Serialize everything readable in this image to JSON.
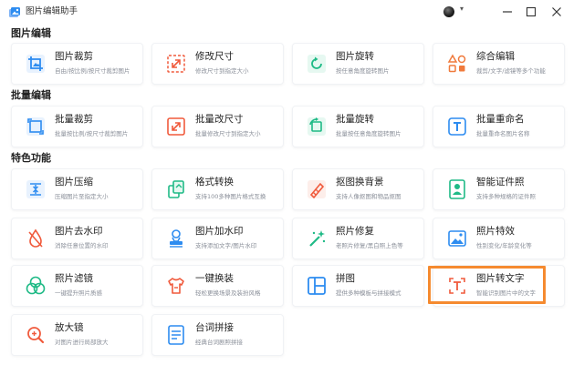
{
  "app": {
    "title": "图片编辑助手",
    "accent": "#2d8cf0"
  },
  "window_controls": {
    "minimize": "minimize-icon",
    "maximize": "maximize-icon",
    "close": "close-icon"
  },
  "sections": [
    {
      "title": "图片编辑"
    },
    {
      "title": "批量编辑"
    },
    {
      "title": "特色功能"
    }
  ],
  "tools": [
    {
      "label": "图片裁剪",
      "desc": "自由/按比例/按尺寸裁剪图片",
      "icon": "crop-icon"
    },
    {
      "label": "修改尺寸",
      "desc": "修改尺寸到指定大小",
      "icon": "resize-icon"
    },
    {
      "label": "图片旋转",
      "desc": "按任意角度旋转图片",
      "icon": "rotate-icon"
    },
    {
      "label": "综合编辑",
      "desc": "裁剪/文字/滤镜等多个功能",
      "icon": "shapes-icon"
    },
    {
      "label": "批量裁剪",
      "desc": "批量按比例/按尺寸裁剪图片",
      "icon": "batch-crop-icon"
    },
    {
      "label": "批量改尺寸",
      "desc": "批量修改尺寸到指定大小",
      "icon": "batch-resize-icon"
    },
    {
      "label": "批量旋转",
      "desc": "批量按任意角度旋转图片",
      "icon": "batch-rotate-icon"
    },
    {
      "label": "批量重命名",
      "desc": "批量重命名图片名称",
      "icon": "rename-icon"
    },
    {
      "label": "图片压缩",
      "desc": "压缩图片至指定大小",
      "icon": "compress-icon"
    },
    {
      "label": "格式转换",
      "desc": "支持100多种图片格式互换",
      "icon": "convert-icon"
    },
    {
      "label": "抠图换背景",
      "desc": "支持人像抠图和物品抠图",
      "icon": "cutout-icon"
    },
    {
      "label": "智能证件照",
      "desc": "支持多种规格的证件照",
      "icon": "id-photo-icon"
    },
    {
      "label": "图片去水印",
      "desc": "消除任意位置的水印",
      "icon": "remove-watermark-icon"
    },
    {
      "label": "图片加水印",
      "desc": "支持添加文字/图片水印",
      "icon": "add-watermark-icon"
    },
    {
      "label": "照片修复",
      "desc": "老照片修复/黑白照上色等",
      "icon": "magic-wand-icon"
    },
    {
      "label": "照片特效",
      "desc": "性别变化/年龄变化等",
      "icon": "effects-icon"
    },
    {
      "label": "照片滤镜",
      "desc": "一键提升照片质感",
      "icon": "filter-icon"
    },
    {
      "label": "一键换装",
      "desc": "轻松更换场景及装扮风格",
      "icon": "outfit-icon"
    },
    {
      "label": "拼图",
      "desc": "提供多种模板与拼接模式",
      "icon": "collage-icon"
    },
    {
      "label": "图片转文字",
      "desc": "智能识别图片中的文字",
      "icon": "ocr-icon"
    },
    {
      "label": "放大镜",
      "desc": "对图片进行局部放大",
      "icon": "magnifier-icon"
    },
    {
      "label": "台词拼接",
      "desc": "经典台词剧照拼接",
      "icon": "subtitle-icon"
    }
  ]
}
